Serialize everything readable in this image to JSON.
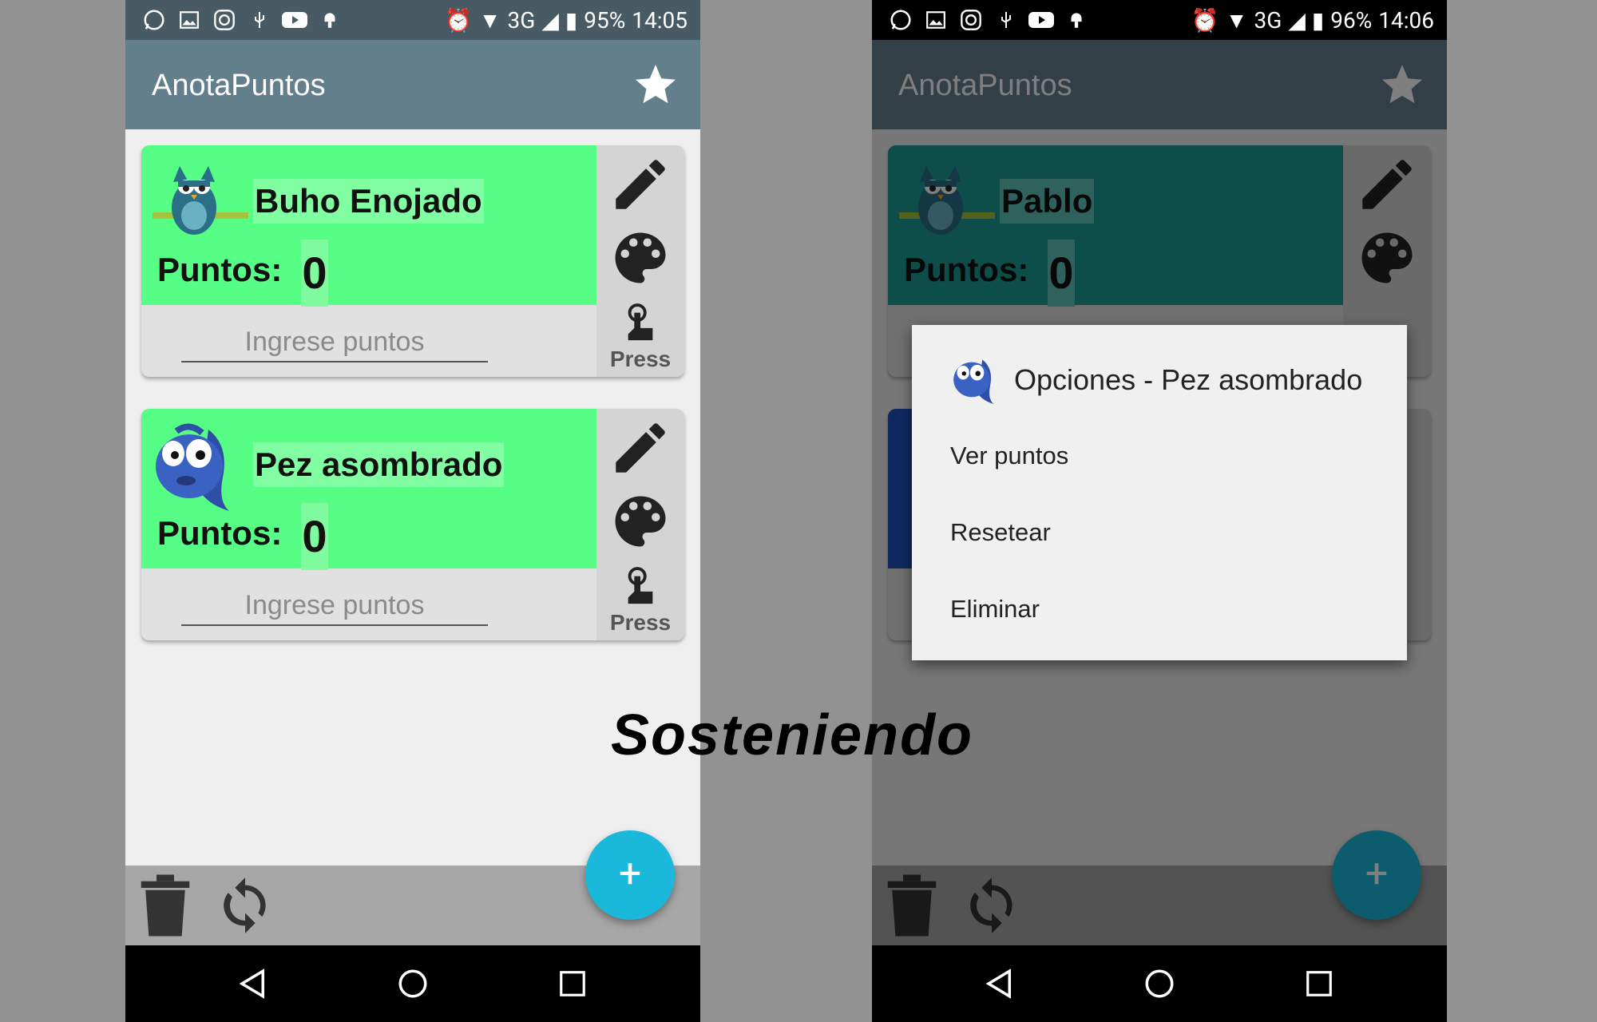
{
  "screens": [
    {
      "status": {
        "battery": "95%",
        "time": "14:05",
        "network": "3G"
      },
      "app_title": "AnotaPuntos",
      "players": [
        {
          "name": "Buho Enojado",
          "points_label": "Puntos:",
          "points": "0",
          "input_placeholder": "Ingrese puntos",
          "press_label": "Press",
          "card_color": "#57fe86",
          "avatar": "owl-icon"
        },
        {
          "name": "Pez asombrado",
          "points_label": "Puntos:",
          "points": "0",
          "input_placeholder": "Ingrese puntos",
          "press_label": "Press",
          "card_color": "#57fe86",
          "avatar": "fish-icon"
        }
      ],
      "fab_label": "+"
    },
    {
      "status": {
        "battery": "96%",
        "time": "14:06",
        "network": "3G"
      },
      "app_title": "AnotaPuntos",
      "players": [
        {
          "name": "Pablo",
          "points_label": "Puntos:",
          "points": "0",
          "card_color": "#1d9c95",
          "avatar": "owl-icon"
        }
      ],
      "fab_label": "+",
      "dialog": {
        "title": "Opciones - Pez asombrado",
        "icon": "fish-icon",
        "items": [
          "Ver puntos",
          "Resetear",
          "Eliminar"
        ]
      }
    }
  ],
  "caption": "Sosteniendo",
  "colors": {
    "accent": "#1ab9db",
    "appbar": "#647f8c",
    "statusbar": "#485a63",
    "card_green": "#57fe86"
  }
}
